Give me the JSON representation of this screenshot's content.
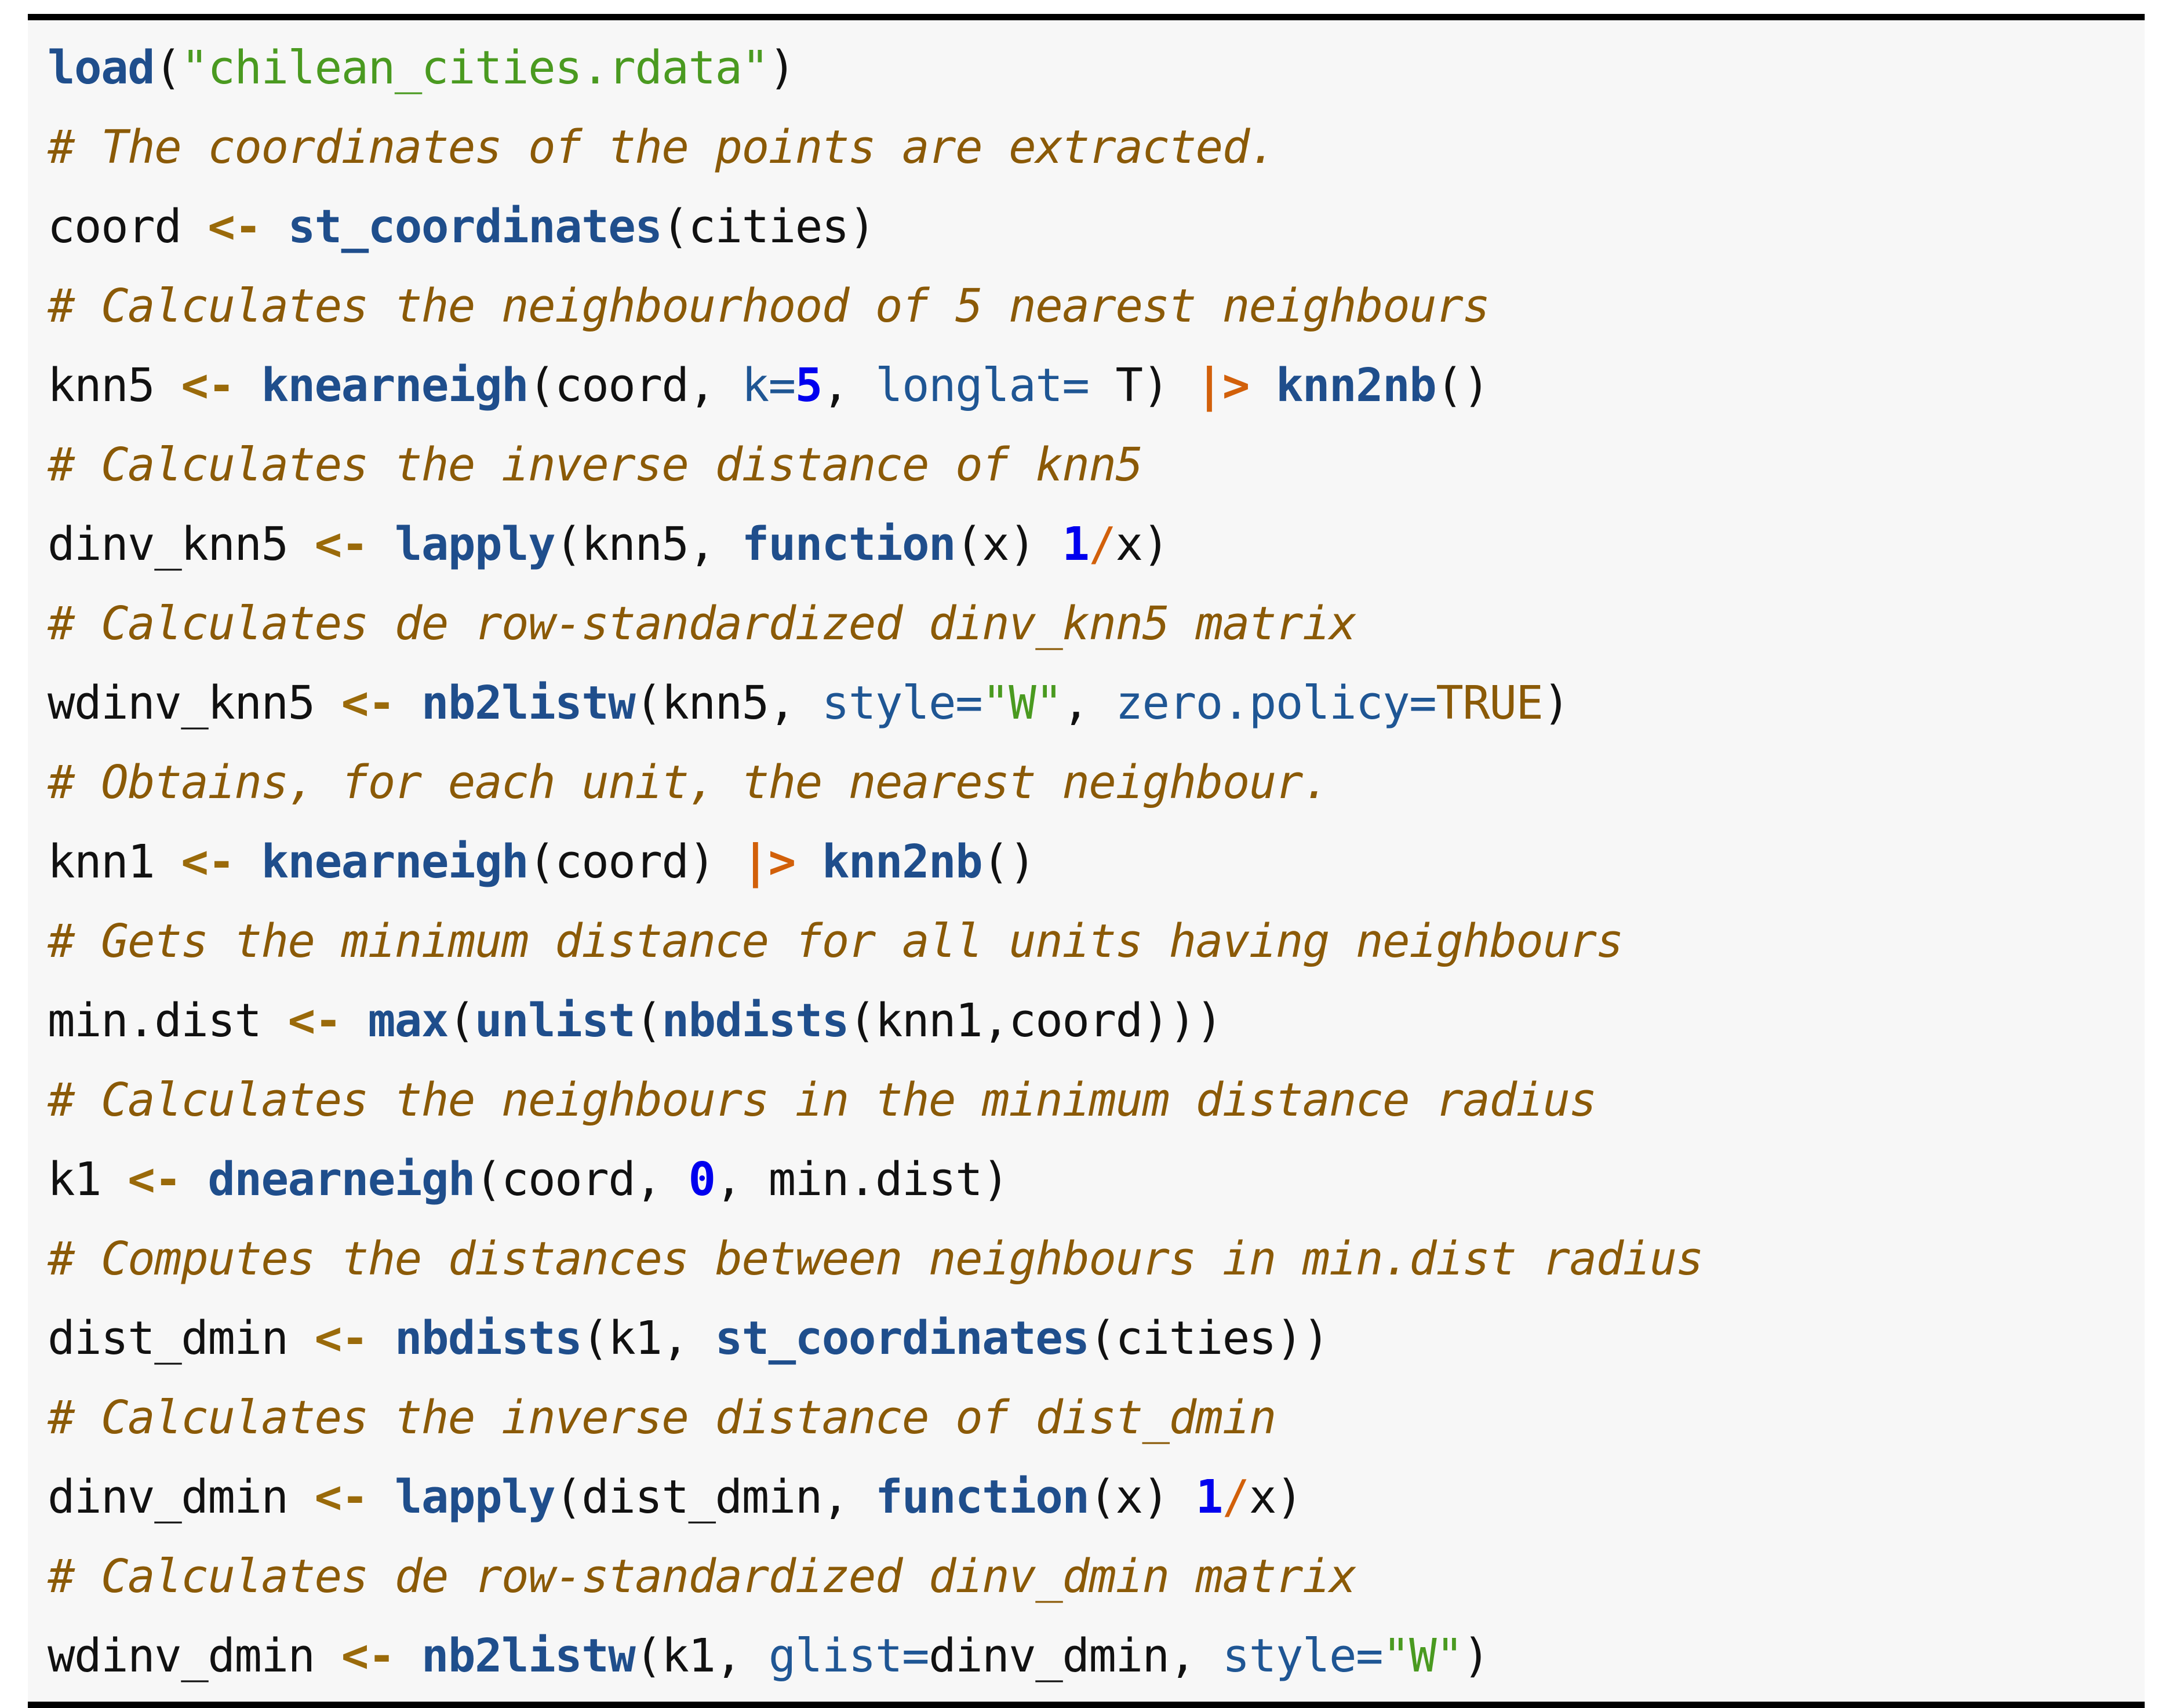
{
  "listing": {
    "language": "R",
    "background_color": "#f7f7f7",
    "rule_color": "#000000",
    "colors": {
      "plain": "#111111",
      "function": "#1f4e8c",
      "keyword": "#1f4e8c",
      "string": "#4a9a20",
      "number": "#0000ee",
      "argument": "#1f5694",
      "operator": "#9a6a0a",
      "pipe": "#d2600a",
      "constant": "#8b5a07",
      "comment": "#8b5a07"
    },
    "lines": [
      {
        "index": 1,
        "kind": "code",
        "text": "load(\"chilean_cities.rdata\")",
        "tokens": [
          {
            "t": "load",
            "c": "fn"
          },
          {
            "t": "(",
            "c": "plain"
          },
          {
            "t": "\"chilean_cities.rdata\"",
            "c": "str"
          },
          {
            "t": ")",
            "c": "plain"
          }
        ]
      },
      {
        "index": 2,
        "kind": "comment",
        "text": "# The coordinates of the points are extracted."
      },
      {
        "index": 3,
        "kind": "code",
        "text": "coord <- st_coordinates(cities)",
        "tokens": [
          {
            "t": "coord ",
            "c": "plain"
          },
          {
            "t": "<-",
            "c": "op"
          },
          {
            "t": " ",
            "c": "plain"
          },
          {
            "t": "st_coordinates",
            "c": "fn"
          },
          {
            "t": "(cities)",
            "c": "plain"
          }
        ]
      },
      {
        "index": 4,
        "kind": "comment",
        "text": "# Calculates the neighbourhood of 5 nearest neighbours"
      },
      {
        "index": 5,
        "kind": "code",
        "text": "knn5 <- knearneigh(coord, k=5, longlat= T) |> knn2nb()",
        "tokens": [
          {
            "t": "knn5 ",
            "c": "plain"
          },
          {
            "t": "<-",
            "c": "op"
          },
          {
            "t": " ",
            "c": "plain"
          },
          {
            "t": "knearneigh",
            "c": "fn"
          },
          {
            "t": "(coord, ",
            "c": "plain"
          },
          {
            "t": "k=",
            "c": "arg"
          },
          {
            "t": "5",
            "c": "num"
          },
          {
            "t": ", ",
            "c": "plain"
          },
          {
            "t": "longlat=",
            "c": "arg"
          },
          {
            "t": " T) ",
            "c": "plain"
          },
          {
            "t": "|>",
            "c": "pipe"
          },
          {
            "t": " ",
            "c": "plain"
          },
          {
            "t": "knn2nb",
            "c": "fn"
          },
          {
            "t": "()",
            "c": "plain"
          }
        ]
      },
      {
        "index": 6,
        "kind": "comment",
        "text": "# Calculates the inverse distance of knn5"
      },
      {
        "index": 7,
        "kind": "code",
        "text": "dinv_knn5 <- lapply(knn5, function(x) 1/x)",
        "tokens": [
          {
            "t": "dinv_knn5 ",
            "c": "plain"
          },
          {
            "t": "<-",
            "c": "op"
          },
          {
            "t": " ",
            "c": "plain"
          },
          {
            "t": "lapply",
            "c": "fn"
          },
          {
            "t": "(knn5, ",
            "c": "plain"
          },
          {
            "t": "function",
            "c": "kw"
          },
          {
            "t": "(x) ",
            "c": "plain"
          },
          {
            "t": "1",
            "c": "num"
          },
          {
            "t": "/",
            "c": "slash"
          },
          {
            "t": "x)",
            "c": "plain"
          }
        ]
      },
      {
        "index": 8,
        "kind": "comment",
        "text": "# Calculates de row-standardized dinv_knn5 matrix"
      },
      {
        "index": 9,
        "kind": "code",
        "text": "wdinv_knn5 <- nb2listw(knn5, style=\"W\", zero.policy=TRUE)",
        "tokens": [
          {
            "t": "wdinv_knn5 ",
            "c": "plain"
          },
          {
            "t": "<-",
            "c": "op"
          },
          {
            "t": " ",
            "c": "plain"
          },
          {
            "t": "nb2listw",
            "c": "fn"
          },
          {
            "t": "(knn5, ",
            "c": "plain"
          },
          {
            "t": "style=",
            "c": "arg"
          },
          {
            "t": "\"W\"",
            "c": "str"
          },
          {
            "t": ", ",
            "c": "plain"
          },
          {
            "t": "zero.policy=",
            "c": "arg"
          },
          {
            "t": "TRUE",
            "c": "const"
          },
          {
            "t": ")",
            "c": "plain"
          }
        ]
      },
      {
        "index": 10,
        "kind": "comment",
        "text": "# Obtains, for each unit, the nearest neighbour."
      },
      {
        "index": 11,
        "kind": "code",
        "text": "knn1 <- knearneigh(coord) |> knn2nb()",
        "tokens": [
          {
            "t": "knn1 ",
            "c": "plain"
          },
          {
            "t": "<-",
            "c": "op"
          },
          {
            "t": " ",
            "c": "plain"
          },
          {
            "t": "knearneigh",
            "c": "fn"
          },
          {
            "t": "(coord) ",
            "c": "plain"
          },
          {
            "t": "|>",
            "c": "pipe"
          },
          {
            "t": " ",
            "c": "plain"
          },
          {
            "t": "knn2nb",
            "c": "fn"
          },
          {
            "t": "()",
            "c": "plain"
          }
        ]
      },
      {
        "index": 12,
        "kind": "comment",
        "text": "# Gets the minimum distance for all units having neighbours"
      },
      {
        "index": 13,
        "kind": "code",
        "text": "min.dist <- max(unlist(nbdists(knn1,coord)))",
        "tokens": [
          {
            "t": "min.dist ",
            "c": "plain"
          },
          {
            "t": "<-",
            "c": "op"
          },
          {
            "t": " ",
            "c": "plain"
          },
          {
            "t": "max",
            "c": "fn"
          },
          {
            "t": "(",
            "c": "plain"
          },
          {
            "t": "unlist",
            "c": "fn"
          },
          {
            "t": "(",
            "c": "plain"
          },
          {
            "t": "nbdists",
            "c": "fn"
          },
          {
            "t": "(knn1,coord)))",
            "c": "plain"
          }
        ]
      },
      {
        "index": 14,
        "kind": "comment",
        "text": "# Calculates the neighbours in the minimum distance radius"
      },
      {
        "index": 15,
        "kind": "code",
        "text": "k1 <- dnearneigh(coord, 0, min.dist)",
        "tokens": [
          {
            "t": "k1 ",
            "c": "plain"
          },
          {
            "t": "<-",
            "c": "op"
          },
          {
            "t": " ",
            "c": "plain"
          },
          {
            "t": "dnearneigh",
            "c": "fn"
          },
          {
            "t": "(coord, ",
            "c": "plain"
          },
          {
            "t": "0",
            "c": "num"
          },
          {
            "t": ", min.dist)",
            "c": "plain"
          }
        ]
      },
      {
        "index": 16,
        "kind": "comment",
        "text": "# Computes the distances between neighbours in min.dist radius"
      },
      {
        "index": 17,
        "kind": "code",
        "text": "dist_dmin <- nbdists(k1, st_coordinates(cities))",
        "tokens": [
          {
            "t": "dist_dmin ",
            "c": "plain"
          },
          {
            "t": "<-",
            "c": "op"
          },
          {
            "t": " ",
            "c": "plain"
          },
          {
            "t": "nbdists",
            "c": "fn"
          },
          {
            "t": "(k1, ",
            "c": "plain"
          },
          {
            "t": "st_coordinates",
            "c": "fn"
          },
          {
            "t": "(cities))",
            "c": "plain"
          }
        ]
      },
      {
        "index": 18,
        "kind": "comment",
        "text": "# Calculates the inverse distance of dist_dmin"
      },
      {
        "index": 19,
        "kind": "code",
        "text": "dinv_dmin <- lapply(dist_dmin, function(x) 1/x)",
        "tokens": [
          {
            "t": "dinv_dmin ",
            "c": "plain"
          },
          {
            "t": "<-",
            "c": "op"
          },
          {
            "t": " ",
            "c": "plain"
          },
          {
            "t": "lapply",
            "c": "fn"
          },
          {
            "t": "(dist_dmin, ",
            "c": "plain"
          },
          {
            "t": "function",
            "c": "kw"
          },
          {
            "t": "(x) ",
            "c": "plain"
          },
          {
            "t": "1",
            "c": "num"
          },
          {
            "t": "/",
            "c": "slash"
          },
          {
            "t": "x)",
            "c": "plain"
          }
        ]
      },
      {
        "index": 20,
        "kind": "comment",
        "text": "# Calculates de row-standardized dinv_dmin matrix"
      },
      {
        "index": 21,
        "kind": "code",
        "text": "wdinv_dmin <- nb2listw(k1, glist=dinv_dmin, style=\"W\")",
        "tokens": [
          {
            "t": "wdinv_dmin ",
            "c": "plain"
          },
          {
            "t": "<-",
            "c": "op"
          },
          {
            "t": " ",
            "c": "plain"
          },
          {
            "t": "nb2listw",
            "c": "fn"
          },
          {
            "t": "(k1, ",
            "c": "plain"
          },
          {
            "t": "glist=",
            "c": "arg"
          },
          {
            "t": "dinv_dmin, ",
            "c": "plain"
          },
          {
            "t": "style=",
            "c": "arg"
          },
          {
            "t": "\"W\"",
            "c": "str"
          },
          {
            "t": ")",
            "c": "plain"
          }
        ]
      }
    ]
  }
}
